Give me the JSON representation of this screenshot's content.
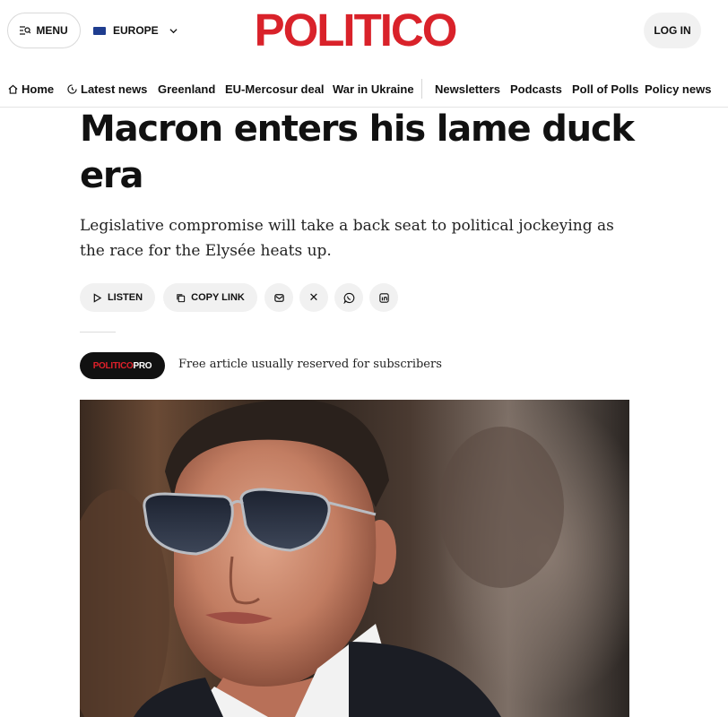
{
  "header": {
    "menu_label": "MENU",
    "region_label": "EUROPE",
    "logo_text": "POLITICO",
    "login_label": "LOG IN"
  },
  "nav": {
    "items": [
      {
        "label": "Home",
        "icon": "home-icon"
      },
      {
        "label": "Latest news",
        "icon": "clock-icon"
      },
      {
        "label": "Greenland"
      },
      {
        "label": "EU-Mercosur deal"
      },
      {
        "label": "War in Ukraine"
      },
      {
        "label": "Newsletters"
      },
      {
        "label": "Podcasts"
      },
      {
        "label": "Poll of Polls"
      },
      {
        "label": "Policy news"
      }
    ]
  },
  "article": {
    "headline": "Macron enters his lame duck era",
    "dek": "Legislative compromise will take a back seat to political jockeying as the race for the Elysée heats up.",
    "share": {
      "listen_label": "LISTEN",
      "copy_link_label": "COPY LINK",
      "icons": [
        "email-icon",
        "x-icon",
        "whatsapp-icon",
        "linkedin-icon"
      ],
      "x_glyph": "𝕏"
    },
    "pro": {
      "badge_part1": "POLITICO",
      "badge_part2": "PRO",
      "note": "Free article usually reserved for subscribers"
    },
    "hero_image": "photo-of-emmanuel-macron-in-aviator-sunglasses"
  },
  "colors": {
    "brand_red": "#d9222a",
    "badge_bg": "#111111",
    "pill_bg": "#f1f1f1"
  }
}
